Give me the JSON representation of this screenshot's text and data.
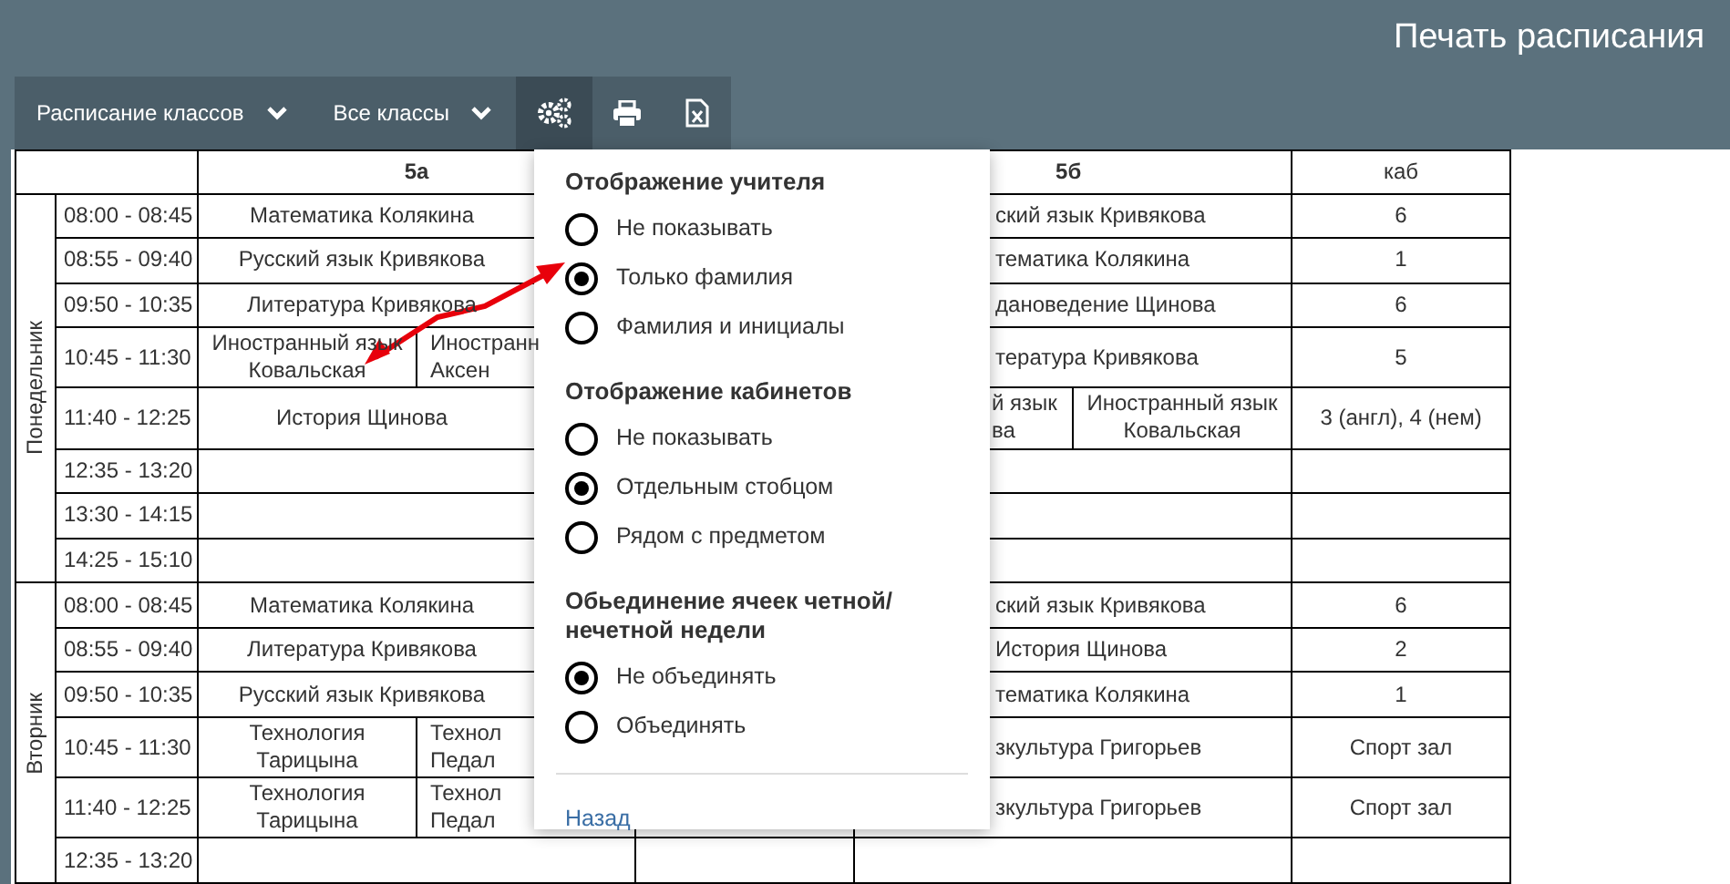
{
  "header": {
    "title": "Печать расписания"
  },
  "toolbar": {
    "dropdowns": [
      {
        "label": "Расписание классов"
      },
      {
        "label": "Все классы"
      }
    ],
    "icon_buttons": [
      {
        "selected": true
      },
      {
        "selected": false
      },
      {
        "selected": false
      }
    ]
  },
  "table": {
    "columns": [
      "5а",
      "5б",
      "каб"
    ],
    "days": [
      {
        "name": "Понедельник",
        "rows": [
          {
            "time": "08:00 - 08:45",
            "class_a": [
              "Математика Колякина"
            ],
            "class_b": [
              "ский язык Кривякова"
            ],
            "room": "6"
          },
          {
            "time": "08:55 - 09:40",
            "class_a": [
              "Русский язык Кривякова"
            ],
            "class_b": [
              "тематика Колякина"
            ],
            "room": "1"
          },
          {
            "time": "09:50 - 10:35",
            "class_a": [
              "Литература Кривякова"
            ],
            "class_b": [
              "дановедение Щинова"
            ],
            "room": "6"
          },
          {
            "time": "10:45 - 11:30",
            "class_a": [
              "Иностранный язык Ковальская",
              "Иностранн Аксен"
            ],
            "class_b": [
              "тература Кривякова"
            ],
            "room": "5"
          },
          {
            "time": "11:40 - 12:25",
            "class_a": [
              "История Щинова"
            ],
            "class_b": [
              "й язык ва",
              "Иностранный язык Ковальская"
            ],
            "room": "3 (англ), 4 (нем)"
          },
          {
            "time": "12:35 - 13:20",
            "class_a": [],
            "class_b": [],
            "room": ""
          },
          {
            "time": "13:30 - 14:15",
            "class_a": [],
            "class_b": [],
            "room": ""
          },
          {
            "time": "14:25 - 15:10",
            "class_a": [],
            "class_b": [],
            "room": ""
          }
        ]
      },
      {
        "name": "Вторник",
        "rows": [
          {
            "time": "08:00 - 08:45",
            "class_a": [
              "Математика Колякина"
            ],
            "class_b": [
              "ский язык Кривякова"
            ],
            "room": "6"
          },
          {
            "time": "08:55 - 09:40",
            "class_a": [
              "Литература Кривякова"
            ],
            "class_b": [
              "История Щинова"
            ],
            "room": "2"
          },
          {
            "time": "09:50 - 10:35",
            "class_a": [
              "Русский язык Кривякова"
            ],
            "class_b": [
              "тематика Колякина"
            ],
            "room": "1"
          },
          {
            "time": "10:45 - 11:30",
            "class_a": [
              "Технология Тарицына",
              "Технол Педал"
            ],
            "class_b": [
              "зкультура Григорьев"
            ],
            "room": "Спорт зал"
          },
          {
            "time": "11:40 - 12:25",
            "class_a": [
              "Технология Тарицына",
              "Технол Педал"
            ],
            "class_b": [
              "зкультура Григорьев"
            ],
            "room": "Спорт зал"
          },
          {
            "time": "12:35 - 13:20",
            "class_a": [],
            "class_b": [],
            "room": ""
          }
        ]
      }
    ]
  },
  "popup": {
    "sections": [
      {
        "title": "Отображение учителя",
        "options": [
          {
            "label": "Не показывать",
            "selected": false
          },
          {
            "label": "Только фамилия",
            "selected": true
          },
          {
            "label": "Фамилия и инициалы",
            "selected": false
          }
        ]
      },
      {
        "title": "Отображение кабинетов",
        "options": [
          {
            "label": "Не показывать",
            "selected": false
          },
          {
            "label": "Отдельным стобцом",
            "selected": true
          },
          {
            "label": "Рядом с предметом",
            "selected": false
          }
        ]
      },
      {
        "title": "Обьединение ячеек четной/ нечетной недели",
        "options": [
          {
            "label": "Не объединять",
            "selected": true
          },
          {
            "label": "Объединять",
            "selected": false
          }
        ]
      }
    ],
    "back_link": "Назад"
  }
}
